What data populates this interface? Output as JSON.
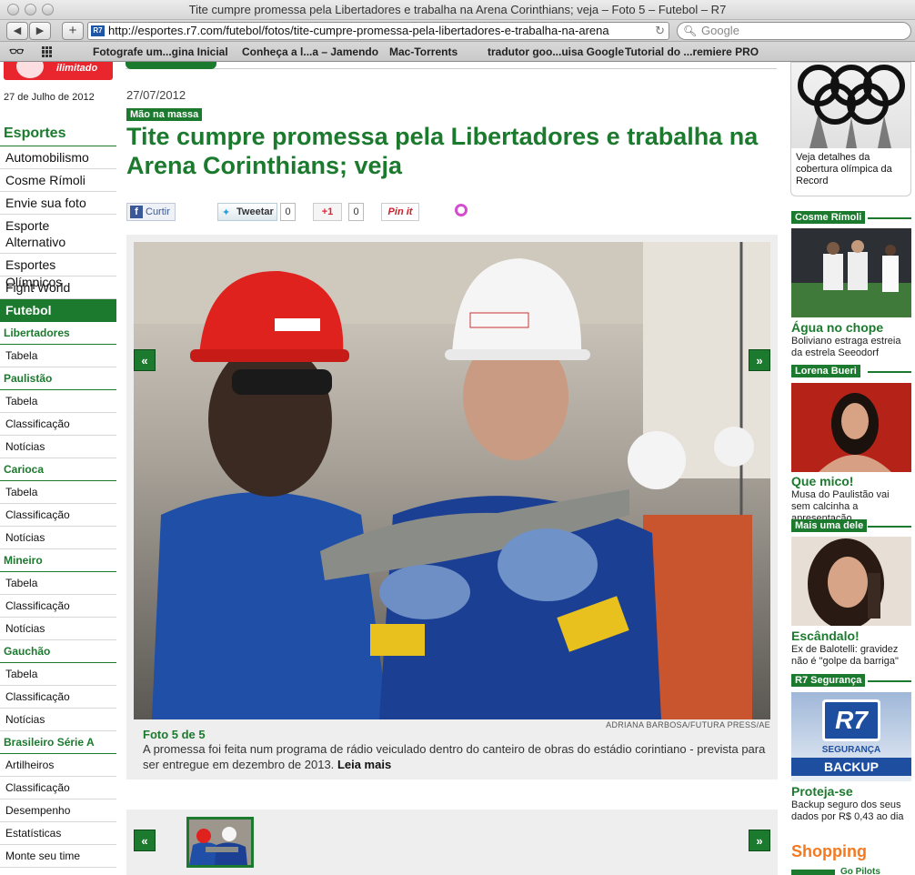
{
  "window": {
    "title": "Tite cumpre promessa pela Libertadores e trabalha na Arena Corinthians; veja – Foto 5 – Futebol – R7"
  },
  "toolbar": {
    "back": "◀",
    "forward": "▶",
    "add": "+",
    "url": "http://esportes.r7.com/futebol/fotos/tite-cumpre-promessa-pela-libertadores-e-trabalha-na-arena",
    "favicon": "R7",
    "search_placeholder": "Google"
  },
  "bookmarks": [
    "Fotografe um...gina Inicial",
    "Conheça a l...a – Jamendo",
    "Mac-Torrents",
    "tradutor goo...uisa Google",
    "Tutorial do ...remiere PRO"
  ],
  "header": {
    "logo_text": "ilimitado",
    "date": "27 de Julho de 2012"
  },
  "sidebar": {
    "heading": "Esportes",
    "items": [
      "Automobilismo",
      "Cosme Rímoli",
      "Envie sua foto",
      "Esporte Alternativo",
      "Esportes Olímpicos",
      "Fight World"
    ],
    "active": "Futebol",
    "groups": [
      {
        "title": "Libertadores",
        "links": [
          "Tabela"
        ]
      },
      {
        "title": "Paulistão",
        "links": [
          "Tabela",
          "Classificação",
          "Notícias"
        ]
      },
      {
        "title": "Carioca",
        "links": [
          "Tabela",
          "Classificação",
          "Notícias"
        ]
      },
      {
        "title": "Mineiro",
        "links": [
          "Tabela",
          "Classificação",
          "Notícias"
        ]
      },
      {
        "title": "Gauchão",
        "links": [
          "Tabela",
          "Classificação",
          "Notícias"
        ]
      },
      {
        "title": "Brasileiro Série A",
        "links": [
          "Artilheiros",
          "Classificação",
          "Desempenho",
          "Estatísticas",
          "Monte seu time"
        ]
      }
    ]
  },
  "article": {
    "date": "27/07/2012",
    "kicker": "Mão na massa",
    "headline": "Tite cumpre promessa pela Libertadores e trabalha na Arena Corinthians; veja",
    "photo_credit": "ADRIANA BARBOSA/FUTURA PRESS/AE",
    "photo_counter": "Foto 5 de 5",
    "caption": "A promessa foi feita num programa de rádio veiculado dentro do canteiro de obras do estádio corintiano - prevista para ser entregue em dezembro de 2013.",
    "read_more": "Leia mais",
    "prev_label": "«",
    "next_label": "»"
  },
  "social": {
    "facebook": "Curtir",
    "twitter": "Tweetar",
    "twitter_count": "0",
    "gplus": "+1",
    "gplus_count": "0",
    "pinterest": "Pin it"
  },
  "right": {
    "olympics_text": "Veja detalhes da cobertura olímpica da Record",
    "cards": [
      {
        "tag": "Cosme Rímoli",
        "title": "Água no chope",
        "desc": "Boliviano estraga estreia da estrela Seeodorf"
      },
      {
        "tag": "Lorena Bueri",
        "title": "Que mico!",
        "desc": "Musa do Paulistão vai sem calcinha a apresentação"
      },
      {
        "tag": "Mais uma dele",
        "title": "Escândalo!",
        "desc": "Ex de Balotelli: gravidez não é \"golpe da barriga\""
      },
      {
        "tag": "R7 Segurança",
        "title": "Proteja-se",
        "desc": "Backup seguro dos seus dados por R$ 0,43 ao dia"
      }
    ],
    "r7_logo": "R7",
    "r7_seg": "SEGURANÇA",
    "r7_backup": "BACKUP",
    "shopping": "Shopping",
    "shopping_sub": "Go Pilots"
  },
  "colors": {
    "accent_green": "#1c7a2e",
    "r7_red": "#e9262e",
    "shopping_orange": "#f47920"
  }
}
